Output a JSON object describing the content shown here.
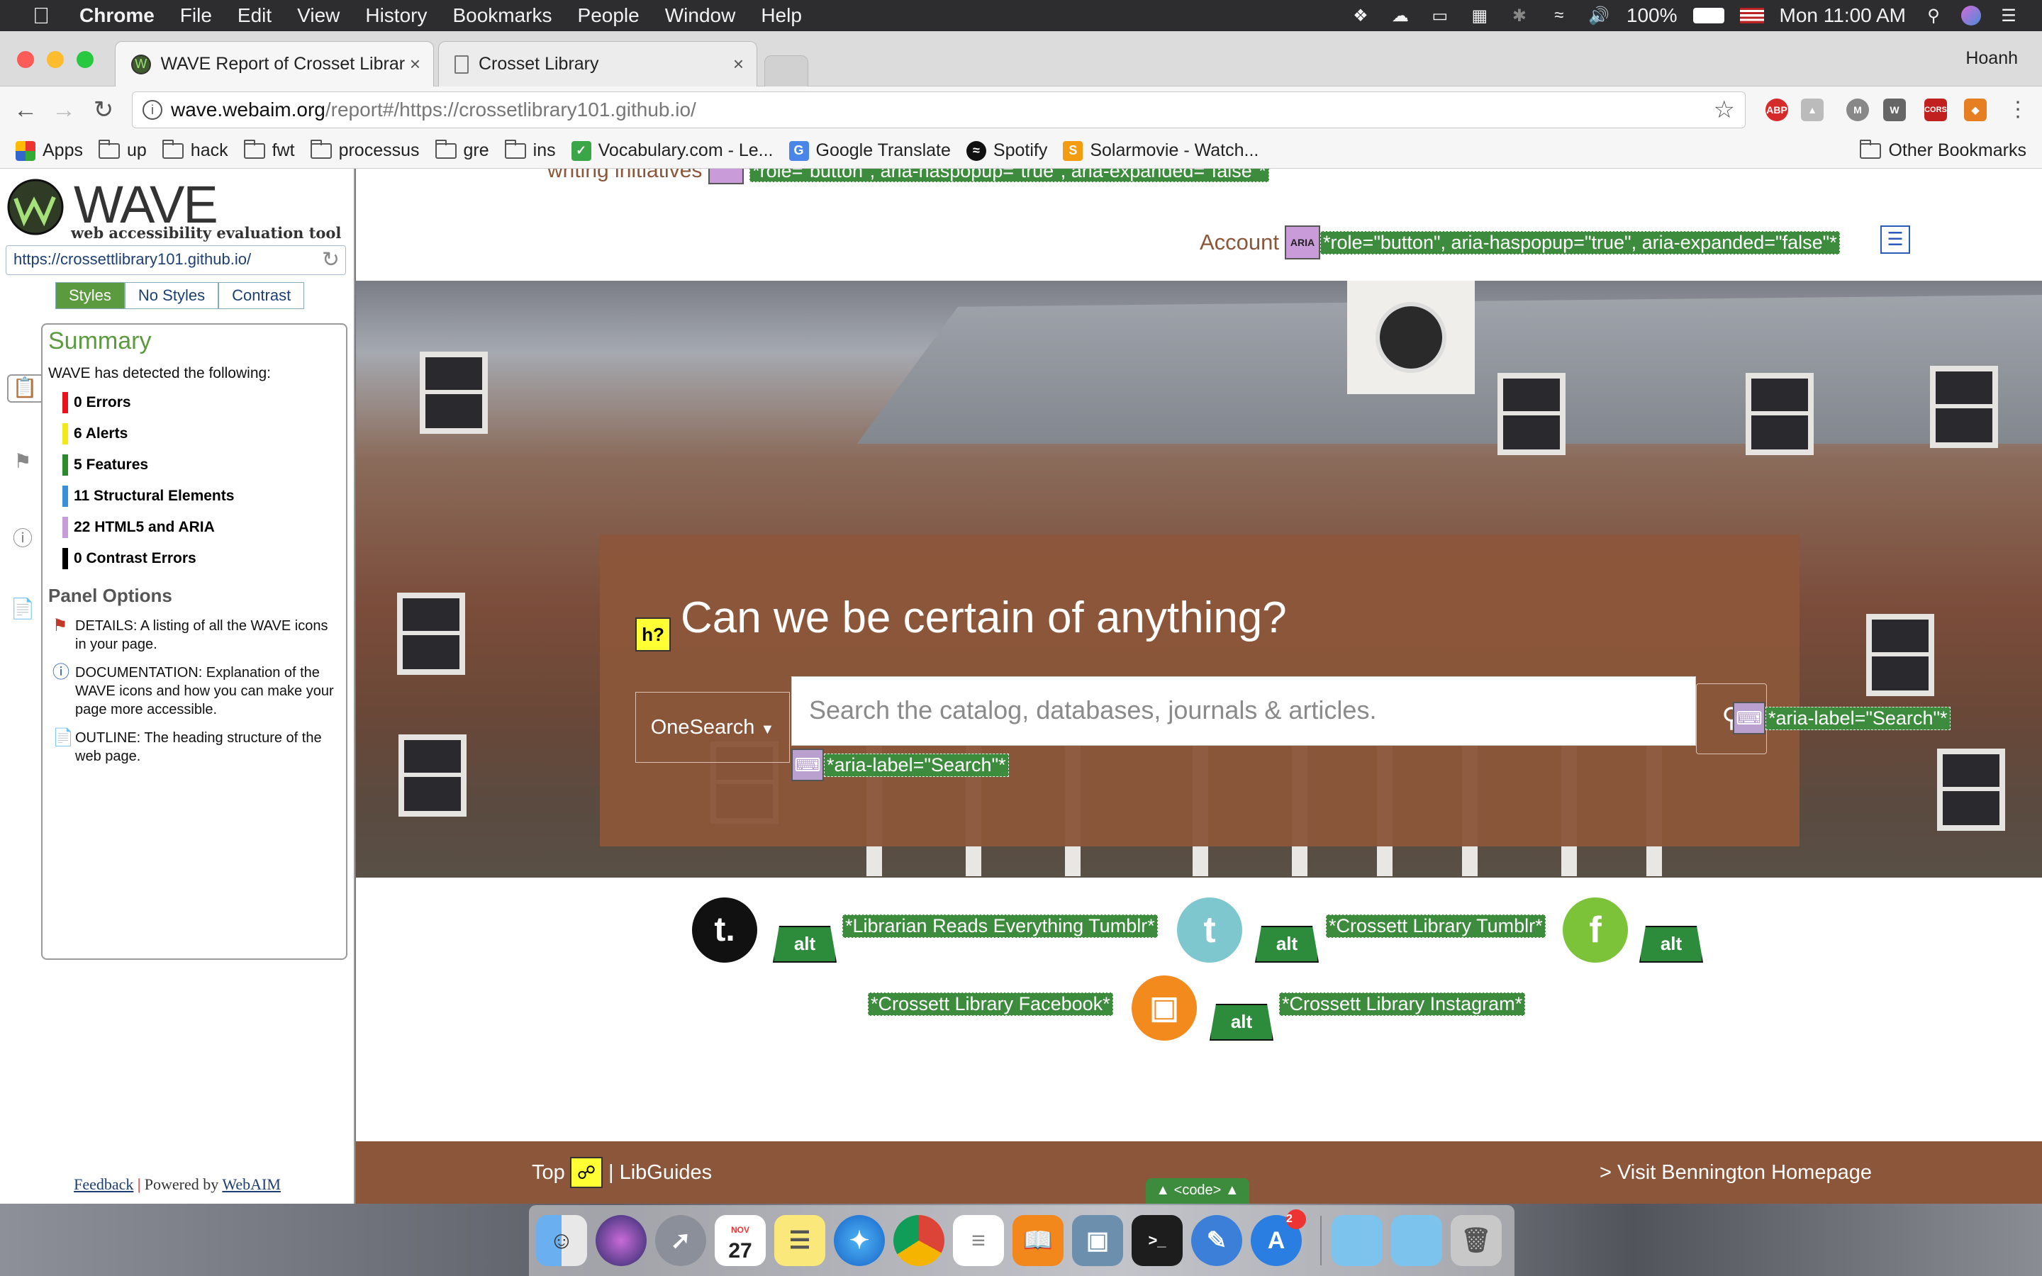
{
  "menubar": {
    "app": "Chrome",
    "items": [
      "File",
      "Edit",
      "View",
      "History",
      "Bookmarks",
      "People",
      "Window",
      "Help"
    ],
    "battery": "100%",
    "clock": "Mon 11:00 AM"
  },
  "browser": {
    "tabs": [
      {
        "title": "WAVE Report of Crosset Librar"
      },
      {
        "title": "Crosset Library"
      }
    ],
    "profile": "Hoanh",
    "url_host": "wave.webaim.org",
    "url_path": "/report#/https://crossetlibrary101.github.io/"
  },
  "bookmarks": [
    "Apps",
    "up",
    "hack",
    "fwt",
    "processus",
    "gre",
    "ins",
    "Vocabulary.com - Le...",
    "Google Translate",
    "Spotify",
    "Solarmovie - Watch...",
    "Other Bookmarks"
  ],
  "wave": {
    "logo": "WAVE",
    "tagline": "web accessibility evaluation tool",
    "url": "https://crossettlibrary101.github.io/",
    "view_tabs": [
      "Styles",
      "No Styles",
      "Contrast"
    ],
    "summary_title": "Summary",
    "summary_intro": "WAVE has detected the following:",
    "summary": [
      {
        "label": "0 Errors",
        "color": "#e8141c"
      },
      {
        "label": "6 Alerts",
        "color": "#f2ea18"
      },
      {
        "label": "5 Features",
        "color": "#2d8a2d"
      },
      {
        "label": "11 Structural Elements",
        "color": "#3a8fd9"
      },
      {
        "label": "22 HTML5 and ARIA",
        "color": "#c89cd8"
      },
      {
        "label": "0 Contrast Errors",
        "color": "#000000"
      }
    ],
    "panel_title": "Panel Options",
    "options": [
      {
        "text": "DETAILS: A listing of all the WAVE icons in your page."
      },
      {
        "text": "DOCUMENTATION: Explanation of the WAVE icons and how you can make your page more accessible."
      },
      {
        "text": "OUTLINE: The heading structure of the web page."
      }
    ],
    "feedback": "Feedback",
    "powered": "Powered by",
    "webaim": "WebAIM"
  },
  "page": {
    "top_partial": "writing initiatives",
    "top_aria": "*role=\"button\", aria-haspopup=\"true\", aria-expanded=\"false\"*",
    "account": "Account",
    "aria_badge": "ARIA",
    "account_aria": "*role=\"button\", aria-haspopup=\"true\", aria-expanded=\"false\"*",
    "heading": "Can we be certain of anything?",
    "heading_badge": "h?",
    "onesearch": "OneSearch",
    "search_placeholder": "Search the catalog, databases, journals & articles.",
    "search_label_1": "*aria-label=\"Search\"*",
    "search_label_2": "*aria-label=\"Search\"*",
    "alt_badge": "alt",
    "social": [
      {
        "alt": "*Librarian Reads Everything Tumblr*"
      },
      {
        "alt": "*Crossett Library Tumblr*"
      },
      {
        "alt": "*Crossett Library Facebook*"
      },
      {
        "alt": "*Crossett Library Instagram*"
      }
    ],
    "footer_top": "Top",
    "footer_libguides": "| LibGuides",
    "footer_home": "> Visit Bennington Homepage",
    "code_toggle": "▲ <code> ▲"
  },
  "dock": {
    "calendar_month": "NOV",
    "calendar_day": "27",
    "badge": "2"
  }
}
